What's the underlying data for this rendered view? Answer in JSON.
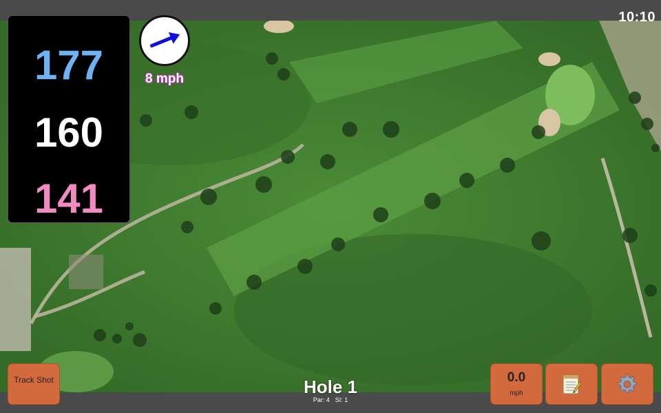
{
  "status": {
    "time": "10:10"
  },
  "distances": {
    "back": "177",
    "center": "160",
    "front": "141"
  },
  "wind": {
    "speed": "8 mph",
    "direction_icon": "arrow-right-icon"
  },
  "hole": {
    "title": "Hole 1",
    "par": "Par: 4",
    "stroke_index": "SI: 1"
  },
  "buttons": {
    "track_shot": "Track Shot",
    "speed_value": "0.0",
    "speed_unit": "mph",
    "notes_icon": "notepad-icon",
    "settings_icon": "gear-icon"
  },
  "colors": {
    "back_distance": "#6fb2f2",
    "center_distance": "#ffffff",
    "front_distance": "#f28bc2",
    "button_bg": "#d36a3d",
    "wind_arrow": "#1010d8"
  }
}
